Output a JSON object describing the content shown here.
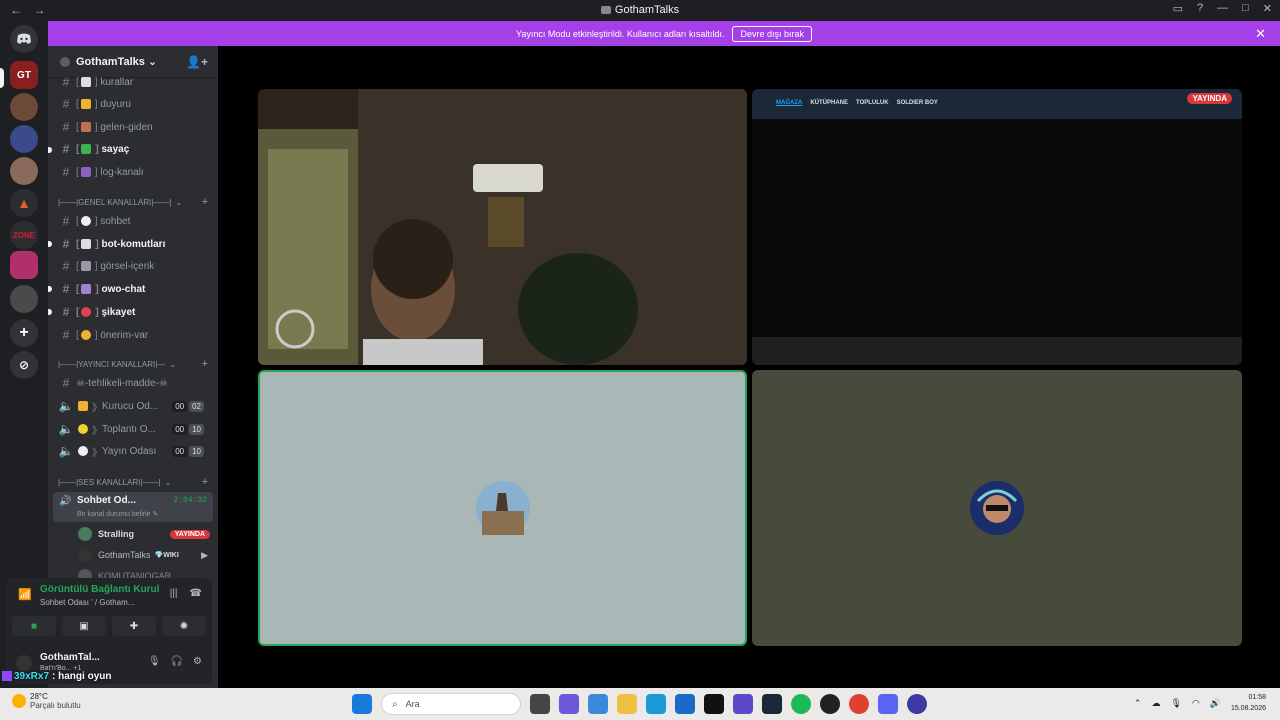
{
  "window": {
    "title": "GothamTalks",
    "back": "←",
    "forward": "→"
  },
  "banner": {
    "text": "Yayıncı Modu etkinleştirildi. Kullanıcı adları kısaltıldı.",
    "button": "Devre dışı bırak",
    "close": "✕"
  },
  "server": {
    "name": "GothamTalks ⌄"
  },
  "channels": {
    "c1": "kurallar",
    "c2": "duyuru",
    "c3": "gelen-giden",
    "c4": "sayaç",
    "c5": "log-kanalı",
    "cat_general": "|——|GENEL KANALLARI|——|",
    "g1": "sohbet",
    "g2": "bot-komutları",
    "g3": "görsel-içerik",
    "g4": "owo-chat",
    "g5": "şikayet",
    "g6": "önerim-var",
    "cat_streamer": "|——|YAYINCI KANALLARI|—",
    "s1": "☠-tehlikeli-madde-☠",
    "s2": "Kurucu Od...",
    "s3": "Toplantı O...",
    "s4": "Yayın Odası",
    "s2a": "00",
    "s2b": "02",
    "s3a": "00",
    "s3b": "10",
    "s4a": "00",
    "s4b": "10",
    "cat_voice": "|——|SES KANALLARI|——|",
    "active": "Sohbet Od...",
    "active_time": "2:04:32",
    "active_status": "Bir kanal durumu belirle ✎"
  },
  "members": {
    "m1": "Stralling",
    "m1_badge": "YAYINDA",
    "m2": "GothamTalks",
    "m2_badge": "💎WIKI",
    "m3": "KOMUTAN|OGAR"
  },
  "voice_panel": {
    "status": "Görüntülü Bağlantı Kurul",
    "sub": "Sohbet Odası ' / Gotham...",
    "user": "GothamTal...",
    "user_sub": "Bat'n'Bo... +1"
  },
  "chat_overlay": {
    "name": "39xRx7",
    "message": ": hangi oyun"
  },
  "tiles": {
    "screen_live": "YAYINDA",
    "steam_tabs": [
      "MAĞAZA",
      "KÜTÜPHANE",
      "TOPLULUK",
      "SOLDIER BOY"
    ]
  },
  "taskbar": {
    "temp": "28°C",
    "weather": "Parçalı bulutlu",
    "search": "Ara",
    "time": "01:58",
    "date": "15.08.2026"
  }
}
